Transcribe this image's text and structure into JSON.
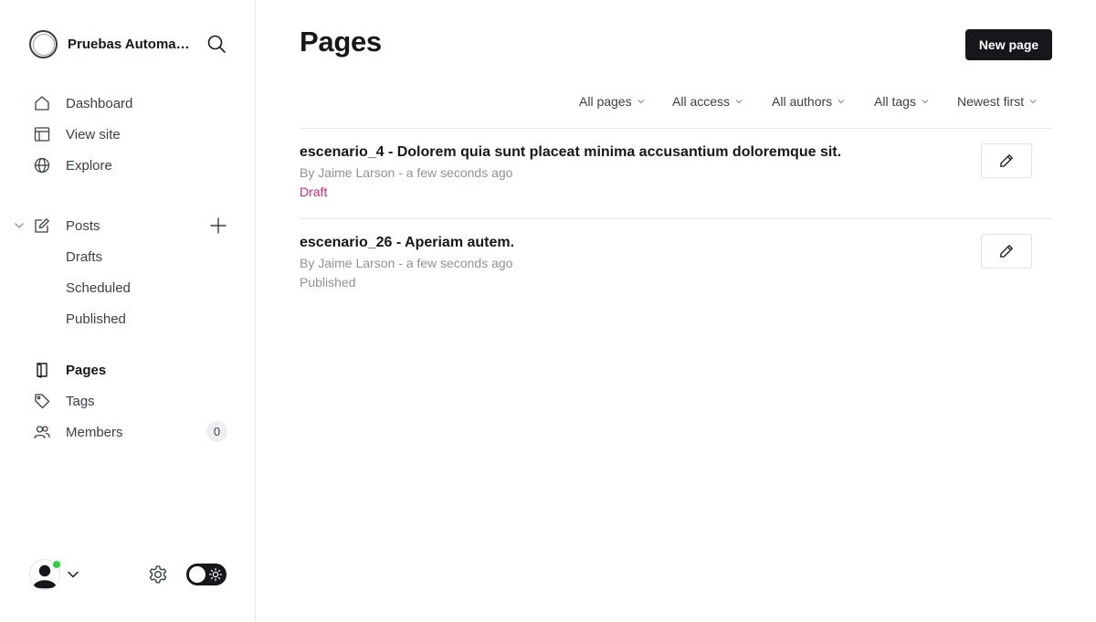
{
  "sidebar": {
    "site_title": "Pruebas Automatizadas",
    "nav": [
      {
        "label": "Dashboard",
        "icon": "home-icon"
      },
      {
        "label": "View site",
        "icon": "view-site-icon"
      },
      {
        "label": "Explore",
        "icon": "globe-icon"
      },
      {
        "label": "Posts",
        "icon": "edit-icon"
      },
      {
        "label": "Pages",
        "icon": "pages-icon"
      },
      {
        "label": "Tags",
        "icon": "tag-icon"
      },
      {
        "label": "Members",
        "icon": "members-icon"
      }
    ],
    "posts_sub": [
      "Drafts",
      "Scheduled",
      "Published"
    ],
    "members_count": "0"
  },
  "main": {
    "title": "Pages",
    "new_button": "New page",
    "filters": [
      "All pages",
      "All access",
      "All authors",
      "All tags",
      "Newest first"
    ],
    "pages": [
      {
        "title": "escenario_4 - Dolorem quia sunt placeat minima accusantium doloremque sit.",
        "meta": "By Jaime Larson - a few seconds ago",
        "status": "Draft"
      },
      {
        "title": "escenario_26 - Aperiam autem.",
        "meta": "By Jaime Larson - a few seconds ago",
        "status": "Published"
      }
    ]
  },
  "colors": {
    "accent_dark": "#15171a",
    "draft": "#e2246e",
    "online": "#30cf43"
  }
}
